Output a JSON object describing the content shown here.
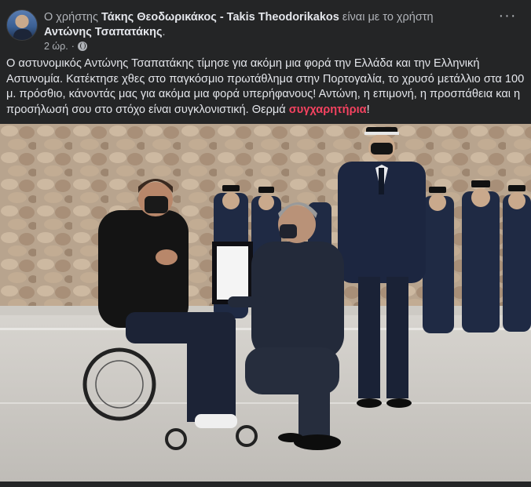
{
  "post": {
    "prefix": "Ο χρήστης",
    "author": "Τάκης Θεοδωρικάκος - Takis Theodorikakos",
    "with_text": "είναι με το χρήστη",
    "tagged": "Αντώνης Τσαπατάκης",
    "period": ".",
    "time": "2 ώρ.",
    "dot": "·",
    "more": "···",
    "text_main": "Ο αστυνομικός Αντώνης Τσαπατάκης τίμησε για ακόμη μια φορά την Ελλάδα και την Ελληνική Αστυνομία. Κατέκτησε χθες  στο παγκόσμιο πρωτάθλημα στην Πορτογαλία, το χρυσό μετάλλιο στα 100 μ. πρόσθιο,  κάνοντάς μας για ακόμα μια φορά υπερήφανους! Αντώνη, η επιμονή, η προσπάθεια και η προσήλωσή σου στο στόχο είναι συγκλονιστική. Θερμά ",
    "text_highlight": "συγχαρητήρια",
    "text_end": "!"
  },
  "icons": {
    "privacy": "globe-icon",
    "menu": "more-options-icon"
  },
  "colors": {
    "background": "#242526",
    "highlight": "#f3425f"
  }
}
